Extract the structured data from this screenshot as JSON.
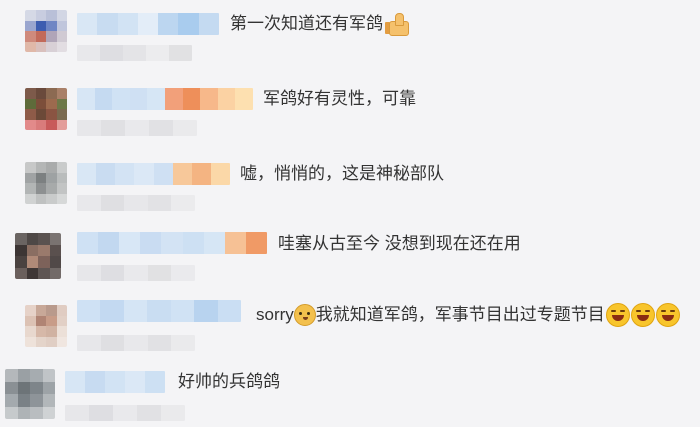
{
  "comments": [
    {
      "text": "第一次知道还有军鸽",
      "emoji_after": "thumbs-up-icon"
    },
    {
      "text": "军鸽好有灵性，可靠"
    },
    {
      "text": "嘘，悄悄的，这是神秘部队"
    },
    {
      "text": "哇塞从古至今 没想到现在还在用"
    },
    {
      "prefix": "sorry",
      "prefix_emoji": "doge-icon",
      "text": "我就知道军鸽，军事节目出过专题节目",
      "trailing_emojis": [
        "laugh-cry-icon",
        "laugh-cry-icon",
        "laugh-cry-icon"
      ]
    },
    {
      "text": "好帅的兵鸽鸽"
    }
  ],
  "colors": {
    "background": "#f4f4f6",
    "text": "#333333",
    "blurred_name": "#c9def2",
    "blurred_meta": "#e4e4e8"
  }
}
